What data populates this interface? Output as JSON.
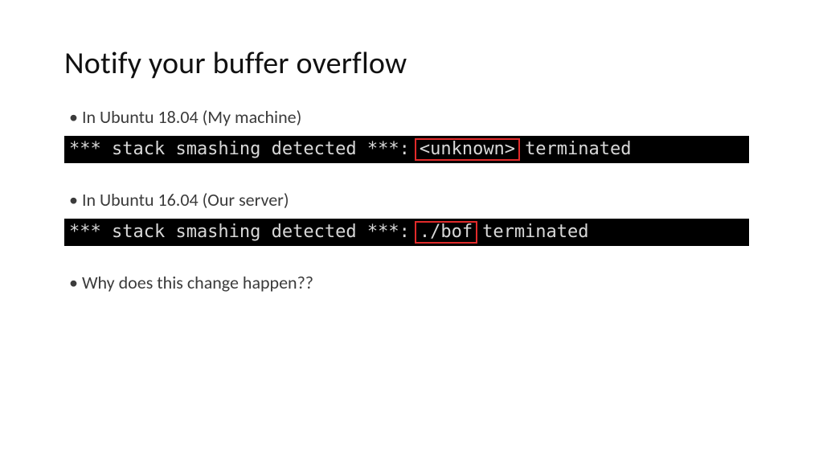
{
  "title": "Notify your buffer overflow",
  "bullets": {
    "b1": "In Ubuntu 18.04 (My machine)",
    "b2": "In Ubuntu 16.04 (Our server)",
    "b3": "Why does this change happen??"
  },
  "terminal1": {
    "prefix": "*** stack smashing detected ***:",
    "highlight": "<unknown>",
    "suffix": "terminated"
  },
  "terminal2": {
    "prefix": "*** stack smashing detected ***:",
    "highlight": "./bof",
    "suffix": "terminated"
  },
  "colors": {
    "highlight_border": "#e22b2b",
    "terminal_bg": "#000000",
    "terminal_fg": "#d8d8d8"
  }
}
